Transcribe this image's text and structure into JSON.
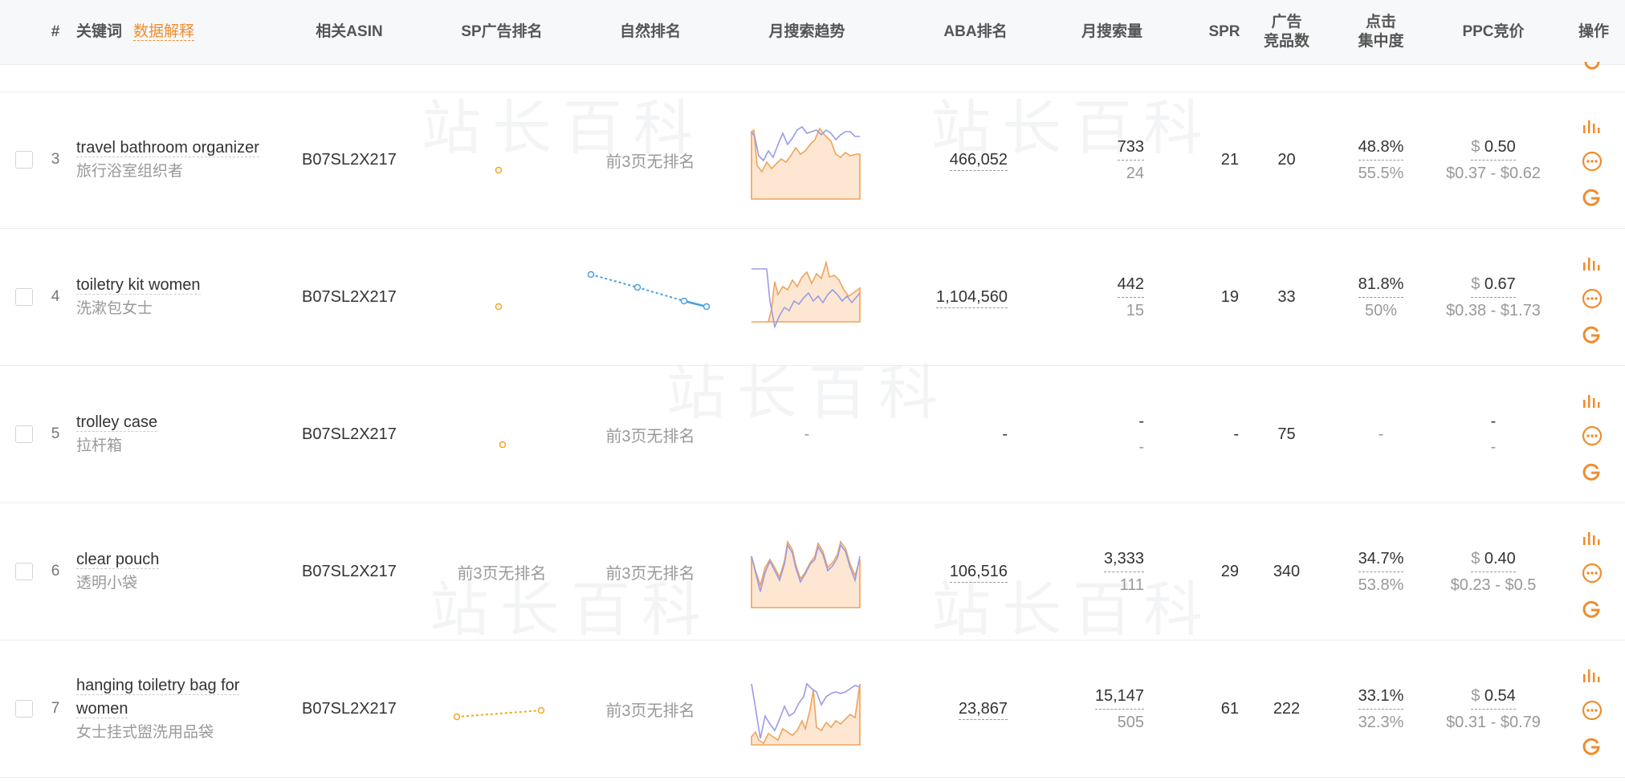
{
  "header": {
    "index": "#",
    "keyword": "关键词",
    "data_explain": "数据解释",
    "asin": "相关ASIN",
    "sp_rank": "SP广告排名",
    "natural_rank": "自然排名",
    "trend": "月搜索趋势",
    "aba_rank": "ABA排名",
    "monthly_search": "月搜索量",
    "spr": "SPR",
    "ad_products_l1": "广告",
    "ad_products_l2": "竞品数",
    "click_conc_l1": "点击",
    "click_conc_l2": "集中度",
    "ppc": "PPC竞价",
    "actions": "操作"
  },
  "watermark_text": "站长百科",
  "rows": [
    {
      "num": "3",
      "keyword_en": "travel bathroom organizer",
      "keyword_cn": "旅行浴室组织者",
      "asin": "B07SL2X217",
      "sp_rank": "",
      "natural_rank": "前3页无排名",
      "aba": "466,052",
      "search_volume": "733",
      "search_sub": "24",
      "spr": "21",
      "ad_products": "20",
      "click_pct": "48.8%",
      "click_sub": "55.5%",
      "ppc_symbol": "$",
      "ppc": "0.50",
      "ppc_range": "$0.37 - $0.62"
    },
    {
      "num": "4",
      "keyword_en": "toiletry kit women",
      "keyword_cn": "洗漱包女士",
      "asin": "B07SL2X217",
      "sp_rank": "",
      "natural_rank": "",
      "aba": "1,104,560",
      "search_volume": "442",
      "search_sub": "15",
      "spr": "19",
      "ad_products": "33",
      "click_pct": "81.8%",
      "click_sub": "50%",
      "ppc_symbol": "$",
      "ppc": "0.67",
      "ppc_range": "$0.38 - $1.73"
    },
    {
      "num": "5",
      "keyword_en": "trolley case",
      "keyword_cn": "拉杆箱",
      "asin": "B07SL2X217",
      "sp_rank": "",
      "natural_rank": "前3页无排名",
      "trend_empty": "-",
      "aba": "-",
      "search_volume": "-",
      "search_sub": "-",
      "spr": "-",
      "ad_products": "75",
      "click_pct": "-",
      "ppc": "-",
      "ppc_range": "-"
    },
    {
      "num": "6",
      "keyword_en": "clear pouch",
      "keyword_cn": "透明小袋",
      "asin": "B07SL2X217",
      "sp_rank": "前3页无排名",
      "natural_rank": "前3页无排名",
      "aba": "106,516",
      "search_volume": "3,333",
      "search_sub": "111",
      "spr": "29",
      "ad_products": "340",
      "click_pct": "34.7%",
      "click_sub": "53.8%",
      "ppc_symbol": "$",
      "ppc": "0.40",
      "ppc_range": "$0.23 - $0.5"
    },
    {
      "num": "7",
      "keyword_en": "hanging toiletry bag for women",
      "keyword_cn": "女士挂式盥洗用品袋",
      "asin": "B07SL2X217",
      "sp_rank": "",
      "natural_rank": "前3页无排名",
      "aba": "23,867",
      "search_volume": "15,147",
      "search_sub": "505",
      "spr": "61",
      "ad_products": "222",
      "click_pct": "33.1%",
      "click_sub": "32.3%",
      "ppc_symbol": "$",
      "ppc": "0.54",
      "ppc_range": "$0.31 - $0.79"
    }
  ],
  "icons": {
    "chart": "bar-chart-icon",
    "more": "more-dots-icon",
    "google": "google-icon"
  },
  "colors": {
    "accent": "#f08c2e",
    "blue": "#4a9fe0",
    "purple": "#9b9be6",
    "fill": "#fde7d2"
  }
}
